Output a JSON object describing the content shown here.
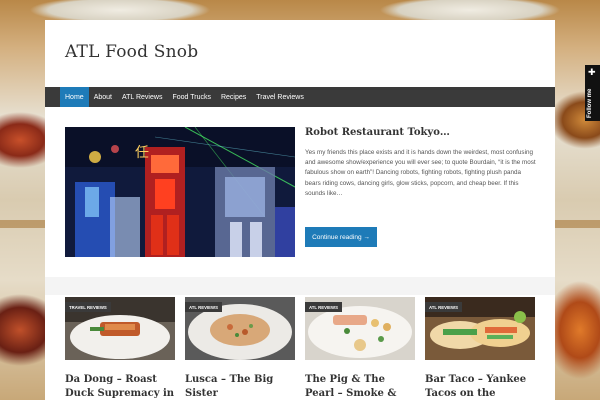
{
  "site": {
    "title": "ATL Food Snob"
  },
  "nav": {
    "items": [
      {
        "label": "Home",
        "active": true
      },
      {
        "label": "About",
        "active": false
      },
      {
        "label": "ATL Reviews",
        "active": false
      },
      {
        "label": "Food Trucks",
        "active": false
      },
      {
        "label": "Recipes",
        "active": false
      },
      {
        "label": "Travel Reviews",
        "active": false
      }
    ]
  },
  "featured": {
    "title": "Robot Restaurant Tokyo…",
    "excerpt": "Yes my friends this place exists and it is hands down the weirdest, most confusing and awesome show/experience you will ever see; to quote Bourdain, “it is the most fabulous show on earth”! Dancing robots, fighting robots, fighting plush panda bears riding cows, dancing girls, glow sticks, popcorn, and cheap beer. If this sounds like…",
    "read_more": "Continue reading →"
  },
  "cards": [
    {
      "category": "Travel Reviews",
      "title": "Da Dong – Roast Duck Supremacy in"
    },
    {
      "category": "ATL Reviews",
      "title": "Lusca – The Big Sister"
    },
    {
      "category": "ATL Reviews",
      "title": "The Pig & The Pearl – Smoke & Finesse"
    },
    {
      "category": "ATL Reviews",
      "title": "Bar Taco – Yankee Tacos on the"
    }
  ],
  "follow": {
    "label": "Follow me",
    "icon": "plus-icon"
  },
  "colors": {
    "accent": "#1e7bb8",
    "nav_bg": "#3a3a3a",
    "follow_bg": "#111111"
  }
}
